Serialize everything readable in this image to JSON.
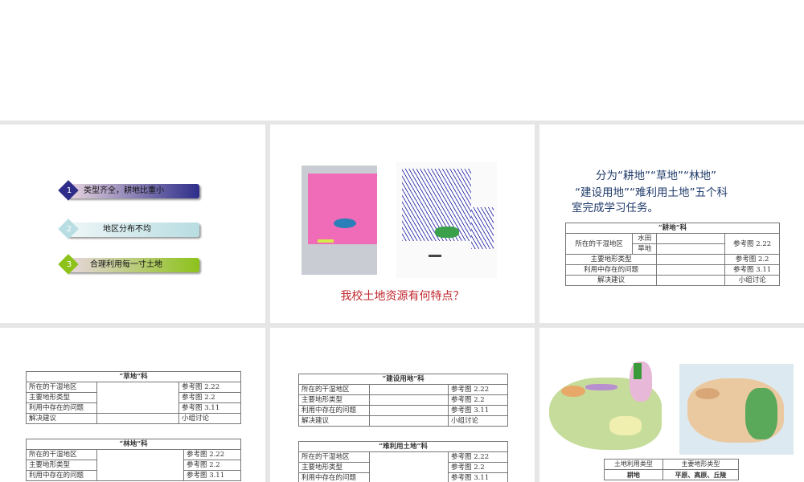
{
  "slide1": {
    "items": [
      {
        "num": "1",
        "label": "类型齐全，耕地比重小",
        "color": "#2e2e8a"
      },
      {
        "num": "2",
        "label": "地区分布不均",
        "color": "#b8dde2"
      },
      {
        "num": "3",
        "label": "合理利用每一寸土地",
        "color": "#8cc21a"
      }
    ]
  },
  "slide2": {
    "question": "我校土地资源有何特点？"
  },
  "slide3": {
    "intro_line1": "分为“耕地”“草地”“林地”",
    "intro_line2": "“建设用地”“难利用土地”五个科",
    "intro_line3": "室完成学习任务。",
    "table": {
      "title": "“耕地”科",
      "region": "所在的干湿地区",
      "paddy": "水田",
      "dry": "旱地",
      "ref_region": "参考图 2.22",
      "terrain": "主要地形类型",
      "ref_terrain": "参考图 2.2",
      "problem": "利用中存在的问题",
      "ref_problem": "参考图 3.11",
      "advice": "解决建议",
      "ref_advice": "小组讨论"
    }
  },
  "rows": {
    "region": "所在的干湿地区",
    "terrain": "主要地形类型",
    "problem": "利用中存在的问题",
    "advice": "解决建议",
    "ref_region": "参考图 2.22",
    "ref_terrain": "参考图 2.2",
    "ref_problem": "参考图 3.11",
    "ref_advice": "小组讨论"
  },
  "slide4": {
    "t1": "“草地”科",
    "t2": "“林地”科"
  },
  "slide5": {
    "t1": "“建设用地”科",
    "t2": "“难利用土地”科"
  },
  "slide6": {
    "col1": "土地利用类型",
    "col2": "主要地形类型",
    "row1_type": "耕地",
    "row1_terrain": "平原、高原、丘陵"
  }
}
